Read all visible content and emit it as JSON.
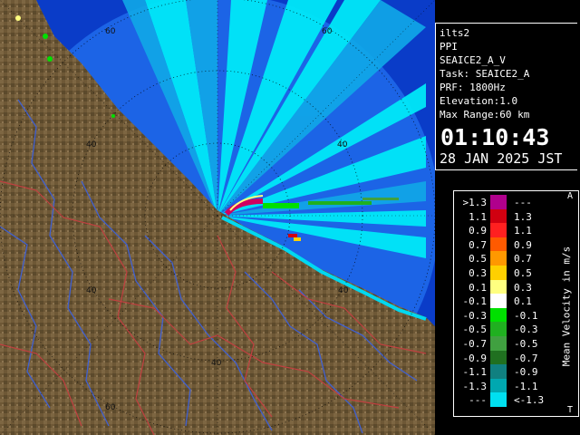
{
  "radar": {
    "range_labels": [
      "60",
      "60",
      "40",
      "40",
      "40",
      "40",
      "40",
      "60"
    ]
  },
  "info": {
    "site": "ilts2",
    "mode": "PPI",
    "product": "SEAICE2_A_V",
    "task": "Task: SEAICE2_A",
    "prf": "PRF: 1800Hz",
    "elevation": "Elevation:1.0",
    "max_range": "Max Range:60 km",
    "time": "01:10:43",
    "date": "28 JAN 2025 JST"
  },
  "legend": {
    "title": "Mean Velocity in m/s",
    "mark_top": "A",
    "mark_bottom": "T",
    "rows": [
      {
        "lo": ">1.3",
        "hi": "---",
        "color": "#b0008c"
      },
      {
        "lo": "1.1",
        "hi": "1.3",
        "color": "#d00010"
      },
      {
        "lo": "0.9",
        "hi": "1.1",
        "color": "#ff2020"
      },
      {
        "lo": "0.7",
        "hi": "0.9",
        "color": "#ff5a00"
      },
      {
        "lo": "0.5",
        "hi": "0.7",
        "color": "#ff9800"
      },
      {
        "lo": "0.3",
        "hi": "0.5",
        "color": "#ffd000"
      },
      {
        "lo": "0.1",
        "hi": "0.3",
        "color": "#ffff80"
      },
      {
        "lo": "-0.1",
        "hi": "0.1",
        "color": "#ffffff"
      },
      {
        "lo": "-0.3",
        "hi": "-0.1",
        "color": "#00e000"
      },
      {
        "lo": "-0.5",
        "hi": "-0.3",
        "color": "#20b020"
      },
      {
        "lo": "-0.7",
        "hi": "-0.5",
        "color": "#40a040"
      },
      {
        "lo": "-0.9",
        "hi": "-0.7",
        "color": "#207020"
      },
      {
        "lo": "-1.1",
        "hi": "-0.9",
        "color": "#108080"
      },
      {
        "lo": "-1.3",
        "hi": "-1.1",
        "color": "#00a8b0"
      },
      {
        "lo": "---",
        "hi": "<-1.3",
        "color": "#00e0f0"
      }
    ]
  },
  "colors": {
    "sea_outer": "#0a3cc8",
    "sea_inner": "#1c64e6",
    "echo_light": "#00e8f8",
    "land": "#6e5836",
    "rivers": "#4060d0",
    "borders": "#c04040"
  }
}
